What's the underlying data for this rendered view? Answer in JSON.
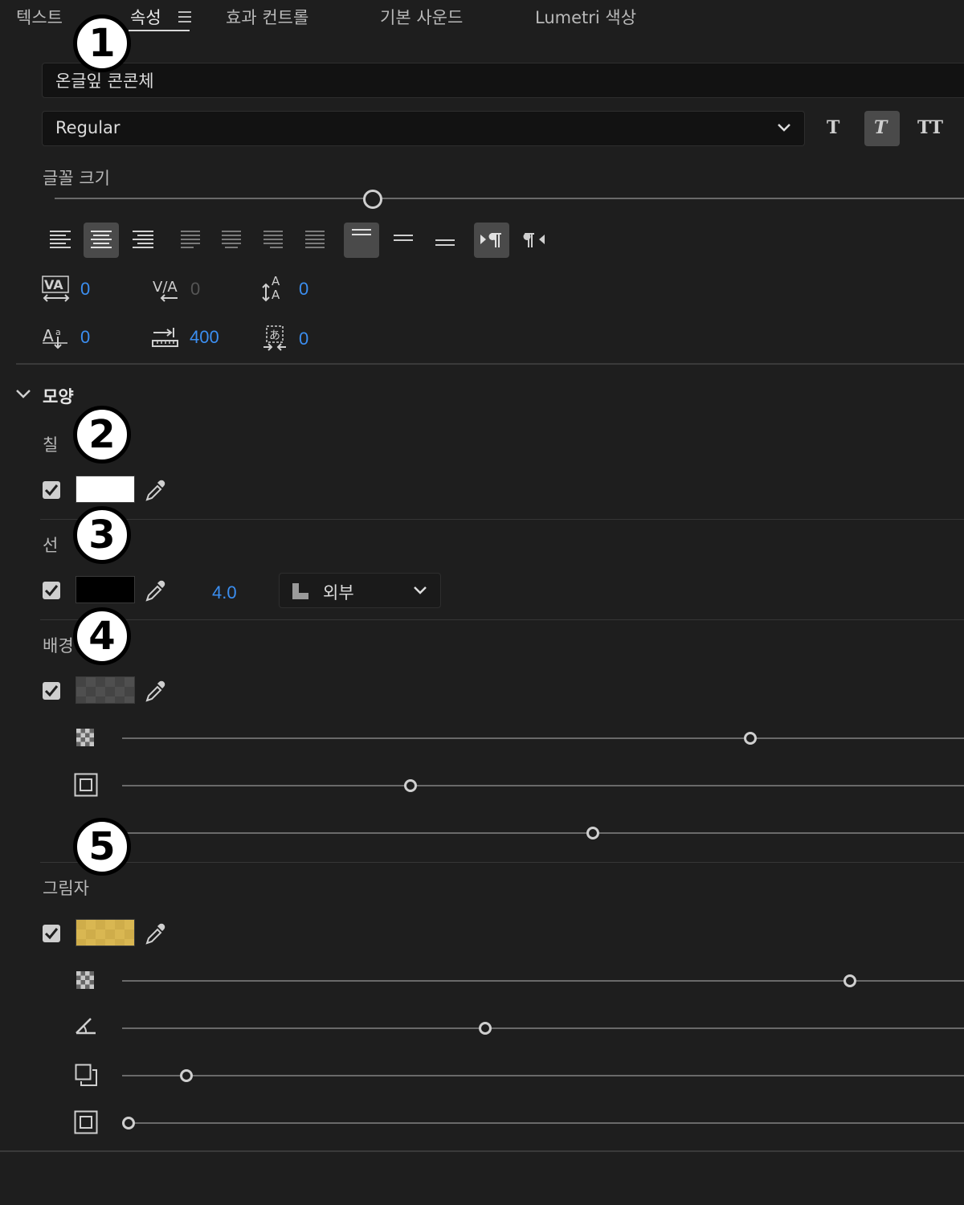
{
  "tabs": [
    {
      "label": "텍스트"
    },
    {
      "label": "속성",
      "active": true
    },
    {
      "label": "효과 컨트롤"
    },
    {
      "label": "기본 사운드"
    },
    {
      "label": "Lumetri 색상"
    }
  ],
  "text_section": {
    "font_name": "온글잎 콘콘체",
    "font_style": "Regular",
    "style_buttons": [
      "T",
      "T",
      "TT"
    ],
    "font_size_label": "글꼴 크기",
    "font_size_slider": 0.33,
    "tracking_value": "0",
    "kerning_value": "0",
    "leading_value": "0",
    "baseline_value": "0",
    "tab_width_value": "400",
    "tsume_value": "0"
  },
  "appearance": {
    "title": "모양",
    "fill": {
      "label": "칠",
      "checked": true,
      "color": "#ffffff"
    },
    "stroke": {
      "label": "선",
      "checked": true,
      "color": "#000000",
      "width": "4.0",
      "type": "외부"
    },
    "background": {
      "label": "배경",
      "checked": true,
      "color": "#4a4a4a",
      "opacity_slider": 0.75,
      "size_slider": 0.34,
      "corner_slider": 0.56
    },
    "shadow": {
      "label": "그림자",
      "checked": true,
      "color": "#d4b24e",
      "opacity_slider": 0.87,
      "angle_slider": 0.43,
      "distance_slider": 0.07,
      "size_slider": 0.0
    }
  },
  "callouts": [
    "1",
    "2",
    "3",
    "4",
    "5"
  ],
  "colors": {
    "accent": "#3b8ef0",
    "panel": "#1e1e1e",
    "field": "#121212"
  }
}
